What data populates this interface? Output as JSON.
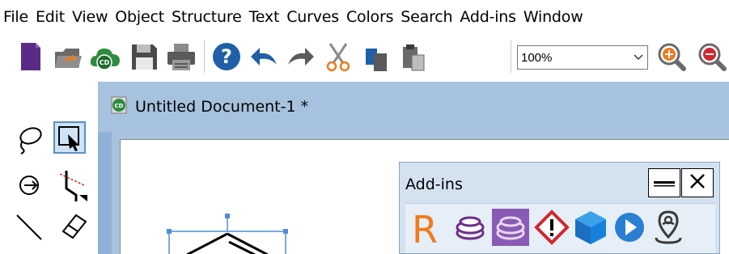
{
  "menubar": {
    "items": [
      "File",
      "Edit",
      "View",
      "Object",
      "Structure",
      "Text",
      "Curves",
      "Colors",
      "Search",
      "Add-ins",
      "Window"
    ]
  },
  "toolbar": {
    "icons": [
      "new-document-icon",
      "open-icon",
      "cloud-open-icon",
      "save-icon",
      "print-icon",
      "help-icon",
      "undo-icon",
      "redo-icon",
      "cut-icon",
      "copy-icon",
      "paste-icon",
      "zoom-in-icon",
      "zoom-out-icon"
    ],
    "zoom": {
      "value": "100%"
    }
  },
  "tools": {
    "items": [
      "lasso-tool-icon",
      "marquee-select-tool-icon",
      "rotate-tool-icon",
      "bond-tool-icon",
      "line-tool-icon",
      "eraser-tool-icon"
    ],
    "selected": "marquee-select-tool-icon"
  },
  "document": {
    "title": "Untitled Document-1 *"
  },
  "addins": {
    "title": "Add-ins",
    "icons": [
      "r-addin-icon",
      "stack-addin-icon",
      "stack-active-addin-icon",
      "hazard-addin-icon",
      "cube-addin-icon",
      "play-addin-icon",
      "location-addin-icon"
    ]
  },
  "colors": {
    "accent": "#2a6fb8",
    "purple": "#5b2a86",
    "green": "#2e8b3e",
    "orange": "#f07a1a",
    "red": "#d0282f"
  }
}
